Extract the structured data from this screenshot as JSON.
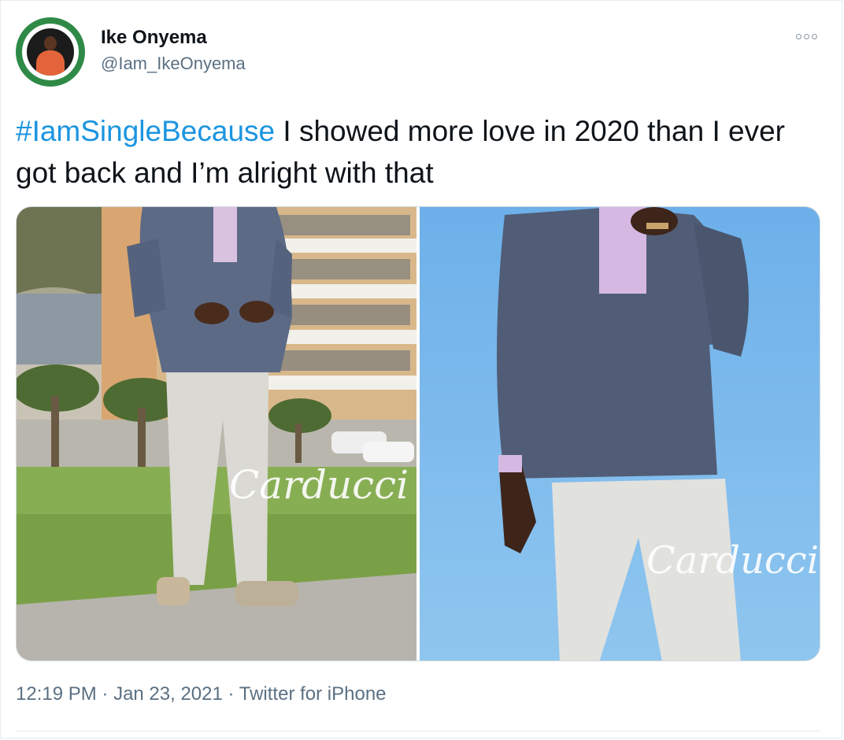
{
  "tweet": {
    "author_name": "Ike Onyema",
    "author_handle": "@Iam_IkeOnyema",
    "hashtag": "#IamSingleBecause",
    "body": " I showed more love in 2020 than I ever got back and I’m alright with that",
    "time": "12:19 PM",
    "date": "Jan 23, 2021",
    "source": "Twitter for iPhone",
    "separator": " · ",
    "more_icon": "more-options-icon"
  },
  "media": {
    "watermark_left": "Carducci",
    "watermark_right": "Carducci"
  },
  "colors": {
    "hashtag": "#1b95e0",
    "secondary_text": "#5b7083",
    "avatar_ring": "#2f8a47"
  }
}
